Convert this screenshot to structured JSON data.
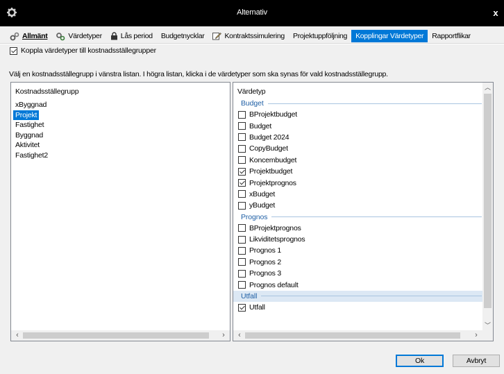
{
  "window": {
    "title": "Alternativ",
    "close_label": "x"
  },
  "tabs": [
    {
      "label": "Allmänt",
      "icon": "gears-icon",
      "active": false
    },
    {
      "label": "Värdetyper",
      "icon": "gears-color-icon",
      "active": false
    },
    {
      "label": "Lås period",
      "icon": "lock-icon",
      "active": false
    },
    {
      "label": "Budgetnycklar",
      "icon": "",
      "active": false
    },
    {
      "label": "Kontraktssimulering",
      "icon": "edit-icon",
      "active": false
    },
    {
      "label": "Projektuppföljning",
      "icon": "",
      "active": false
    },
    {
      "label": "Kopplingar Värdetyper",
      "icon": "",
      "active": true
    },
    {
      "label": "Rapportflikar",
      "icon": "",
      "active": false
    }
  ],
  "link_checkbox": {
    "label": "Koppla värdetyper till kostnadsställegrupper",
    "checked": true
  },
  "instruction": "Välj en kostnadsställegrupp i vänstra listan. I högra listan, klicka i de värdetyper som ska synas för vald kostnadsställegrupp.",
  "left_list": {
    "header": "Kostnadsställegrupp",
    "items": [
      "xByggnad",
      "Projekt",
      "Fastighet",
      "Byggnad",
      "Aktivitet",
      "Fastighet2"
    ],
    "selected": "Projekt"
  },
  "right_list": {
    "header": "Värdetyp",
    "groups": [
      {
        "name": "Budget",
        "items": [
          {
            "label": "BProjektbudget",
            "checked": false
          },
          {
            "label": "Budget",
            "checked": false
          },
          {
            "label": "Budget 2024",
            "checked": false
          },
          {
            "label": "CopyBudget",
            "checked": false
          },
          {
            "label": "Koncembudget",
            "checked": false
          },
          {
            "label": "Projektbudget",
            "checked": true
          },
          {
            "label": "Projektprognos",
            "checked": true
          },
          {
            "label": "xBudget",
            "checked": false
          },
          {
            "label": "yBudget",
            "checked": false
          }
        ]
      },
      {
        "name": "Prognos",
        "items": [
          {
            "label": "BProjektprognos",
            "checked": false
          },
          {
            "label": "Likviditetsprognos",
            "checked": false
          },
          {
            "label": "Prognos 1",
            "checked": false
          },
          {
            "label": "Prognos 2",
            "checked": false
          },
          {
            "label": "Prognos 3",
            "checked": false
          },
          {
            "label": "Prognos default",
            "checked": false
          }
        ]
      },
      {
        "name": "Utfall",
        "highlighted": true,
        "items": [
          {
            "label": "Utfall",
            "checked": true
          }
        ]
      }
    ]
  },
  "buttons": {
    "ok": "Ok",
    "cancel": "Avbryt"
  },
  "colors": {
    "accent": "#0078d7",
    "group_header": "#1f5fa5",
    "titlebar": "#000000"
  }
}
